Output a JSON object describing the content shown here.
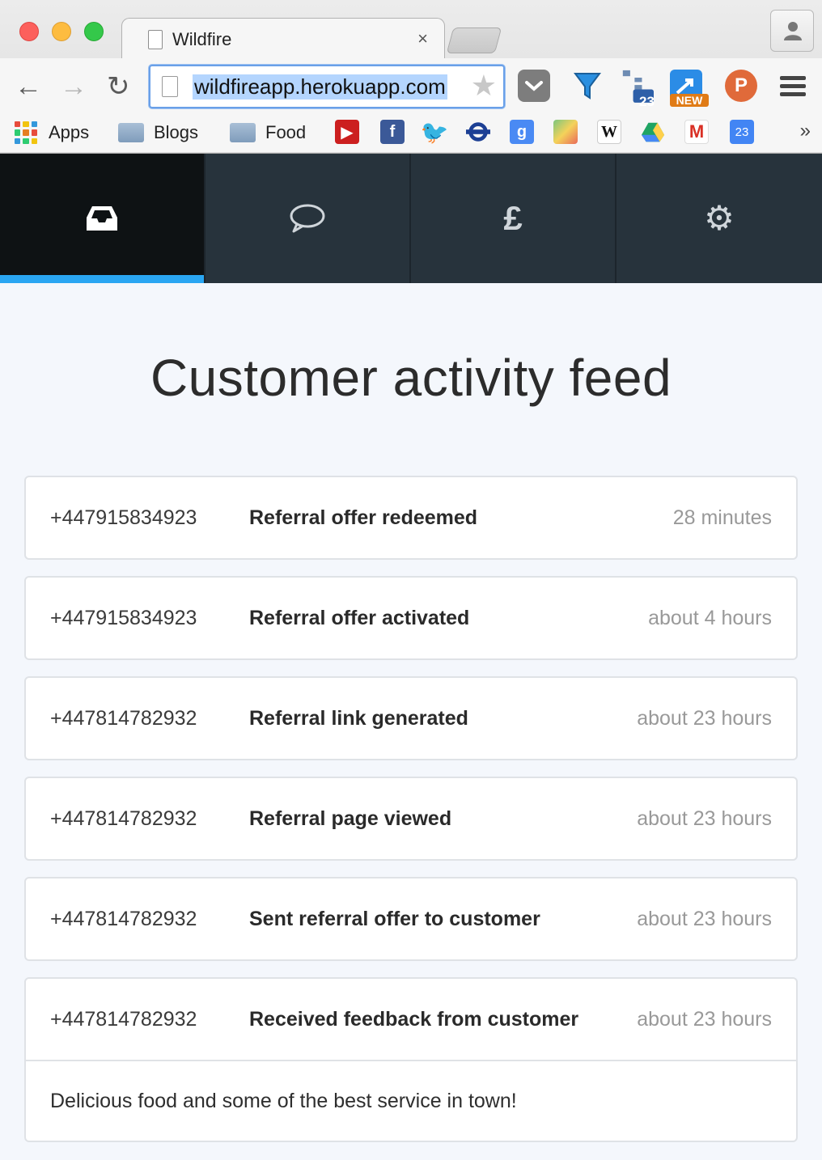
{
  "browser": {
    "tab_title": "Wildfire",
    "tab_close": "×",
    "url": "wildfireapp.herokuapp.com",
    "back": "←",
    "forward": "→",
    "reload": "↻",
    "star": "★",
    "extensions": {
      "badge_23": "23",
      "new_label": "NEW",
      "p_label": "P",
      "calendar_23": "23"
    },
    "bookmarks": [
      {
        "label": "Apps"
      },
      {
        "label": "Blogs"
      },
      {
        "label": "Food"
      }
    ],
    "overflow": "»"
  },
  "appnav": {
    "tabs": [
      {
        "name": "inbox",
        "icon": "inbox-icon",
        "active": true
      },
      {
        "name": "messages",
        "icon": "speech-bubble-icon",
        "glyph": "💬"
      },
      {
        "name": "payments",
        "icon": "pound-icon",
        "glyph": "£"
      },
      {
        "name": "settings",
        "icon": "gear-icon",
        "glyph": "⚙"
      }
    ],
    "accent": "#2aa6f2"
  },
  "main": {
    "title": "Customer activity feed",
    "feed": [
      {
        "phone": "+447915834923",
        "event": "Referral offer redeemed",
        "time": "28 minutes"
      },
      {
        "phone": "+447915834923",
        "event": "Referral offer activated",
        "time": "about 4 hours"
      },
      {
        "phone": "+447814782932",
        "event": "Referral link generated",
        "time": "about 23 hours"
      },
      {
        "phone": "+447814782932",
        "event": "Referral page viewed",
        "time": "about 23 hours"
      },
      {
        "phone": "+447814782932",
        "event": "Sent referral offer to customer",
        "time": "about 23 hours"
      },
      {
        "phone": "+447814782932",
        "event": "Received feedback from customer",
        "time": "about 23 hours",
        "note": "Delicious food and some of the best service in town!"
      }
    ]
  }
}
